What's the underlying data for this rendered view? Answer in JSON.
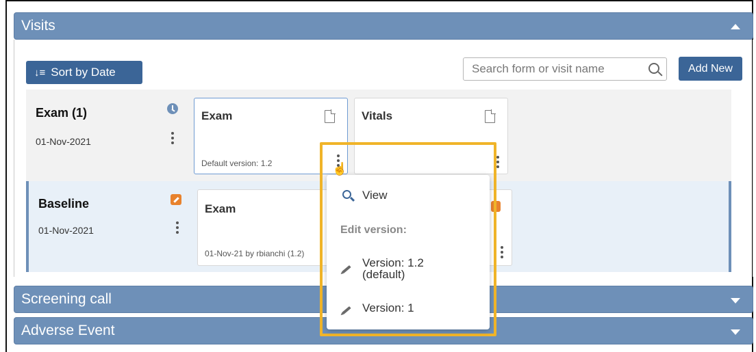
{
  "visits_header": {
    "title": "Visits"
  },
  "toolbar": {
    "sort_label": "Sort by Date",
    "sort_icon_glyph": "↓≡",
    "search_placeholder": "Search form or visit name",
    "add_label": "Add New"
  },
  "visits": [
    {
      "name": "Exam (1)",
      "date": "01-Nov-2021",
      "status_icon": "clock-icon",
      "forms": [
        {
          "title": "Exam",
          "footer": "Default version: 1.2",
          "icon": "document-icon",
          "active": true
        },
        {
          "title": "Vitals",
          "footer": "",
          "icon": "document-icon",
          "active": false
        }
      ]
    },
    {
      "name": "Baseline",
      "date": "01-Nov-2021",
      "status_icon": "edit-icon",
      "forms": [
        {
          "title": "Exam",
          "footer": "01-Nov-21 by rbianchi (1.2)",
          "icon": "status-badge",
          "active": false
        }
      ]
    }
  ],
  "context_menu": {
    "view_label": "View",
    "section_label": "Edit version:",
    "versions": [
      "Version: 1.2\n(default)",
      "Version: 1"
    ]
  },
  "collapsed_panels": [
    {
      "title": "Screening call"
    },
    {
      "title": "Adverse Event"
    }
  ],
  "colors": {
    "panel_header": "#6e90b8",
    "button": "#3b6597",
    "highlight": "#f0b429",
    "edit_badge": "#e8822d",
    "green_badge": "#3fa45b"
  }
}
